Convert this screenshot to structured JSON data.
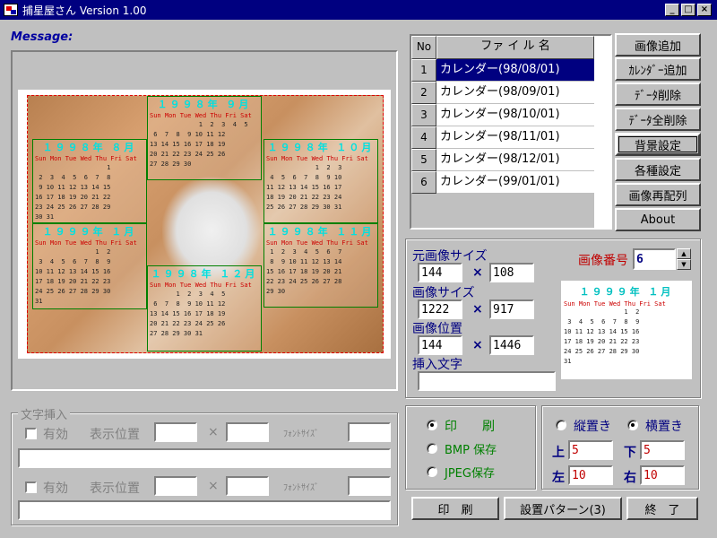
{
  "window": {
    "title": "捕星屋さん Version 1.00"
  },
  "message_label": "Message:",
  "file_table": {
    "headers": [
      "No",
      "ファ イ ル 名"
    ],
    "rows": [
      {
        "no": "1",
        "name": "カレンダー(98/08/01)",
        "selected": true
      },
      {
        "no": "2",
        "name": "カレンダー(98/09/01)"
      },
      {
        "no": "3",
        "name": "カレンダー(98/10/01)"
      },
      {
        "no": "4",
        "name": "カレンダー(98/11/01)"
      },
      {
        "no": "5",
        "name": "カレンダー(98/12/01)"
      },
      {
        "no": "6",
        "name": "カレンダー(99/01/01)"
      }
    ]
  },
  "side_buttons": [
    "画像追加",
    "ｶﾚﾝﾀﾞｰ追加",
    "ﾃﾞｰﾀ削除",
    "ﾃﾞｰﾀ全削除",
    "背景設定",
    "各種設定",
    "画像再配列",
    "About"
  ],
  "calendars": [
    {
      "title": "１９９８年 ９月"
    },
    {
      "title": "１９９８年 ８月"
    },
    {
      "title": "１９９８年 １０月"
    },
    {
      "title": "１９９９年 １月"
    },
    {
      "title": "１９９８年 １２月"
    },
    {
      "title": "１９９８年 １１月"
    }
  ],
  "cal_days": "Sun Mon Tue Wed Thu Fri Sat",
  "params": {
    "orig_size_label": "元画像サイズ",
    "orig_w": "144",
    "orig_h": "108",
    "img_size_label": "画像サイズ",
    "img_w": "1222",
    "img_h": "917",
    "img_pos_label": "画像位置",
    "pos_x": "144",
    "pos_y": "1446",
    "insert_text_label": "挿入文字",
    "insert_text": "",
    "times": "×",
    "img_num_label": "画像番号",
    "img_num": "6"
  },
  "preview": {
    "title": "１９９９年 １月"
  },
  "text_insert": {
    "group_label": "文字挿入",
    "enabled_label": "有効",
    "pos_label": "表示位置",
    "times": "×",
    "font_label": "ﾌｫﾝﾄｻｲｽﾞ"
  },
  "output": {
    "print": "印　　刷",
    "bmp": "BMP 保存",
    "jpeg": "JPEG保存"
  },
  "orientation": {
    "vertical": "縦置き",
    "horizontal": "横置き",
    "top": "上",
    "top_val": "5",
    "bottom": "下",
    "bottom_val": "5",
    "left": "左",
    "left_val": "10",
    "right": "右",
    "right_val": "10"
  },
  "bottom_buttons": {
    "print": "印　刷",
    "pattern": "設置パターン(3)",
    "exit": "終　了"
  },
  "colors": {
    "title_bar": "#000080",
    "selection": "#000080",
    "accent_red": "#c00000"
  }
}
